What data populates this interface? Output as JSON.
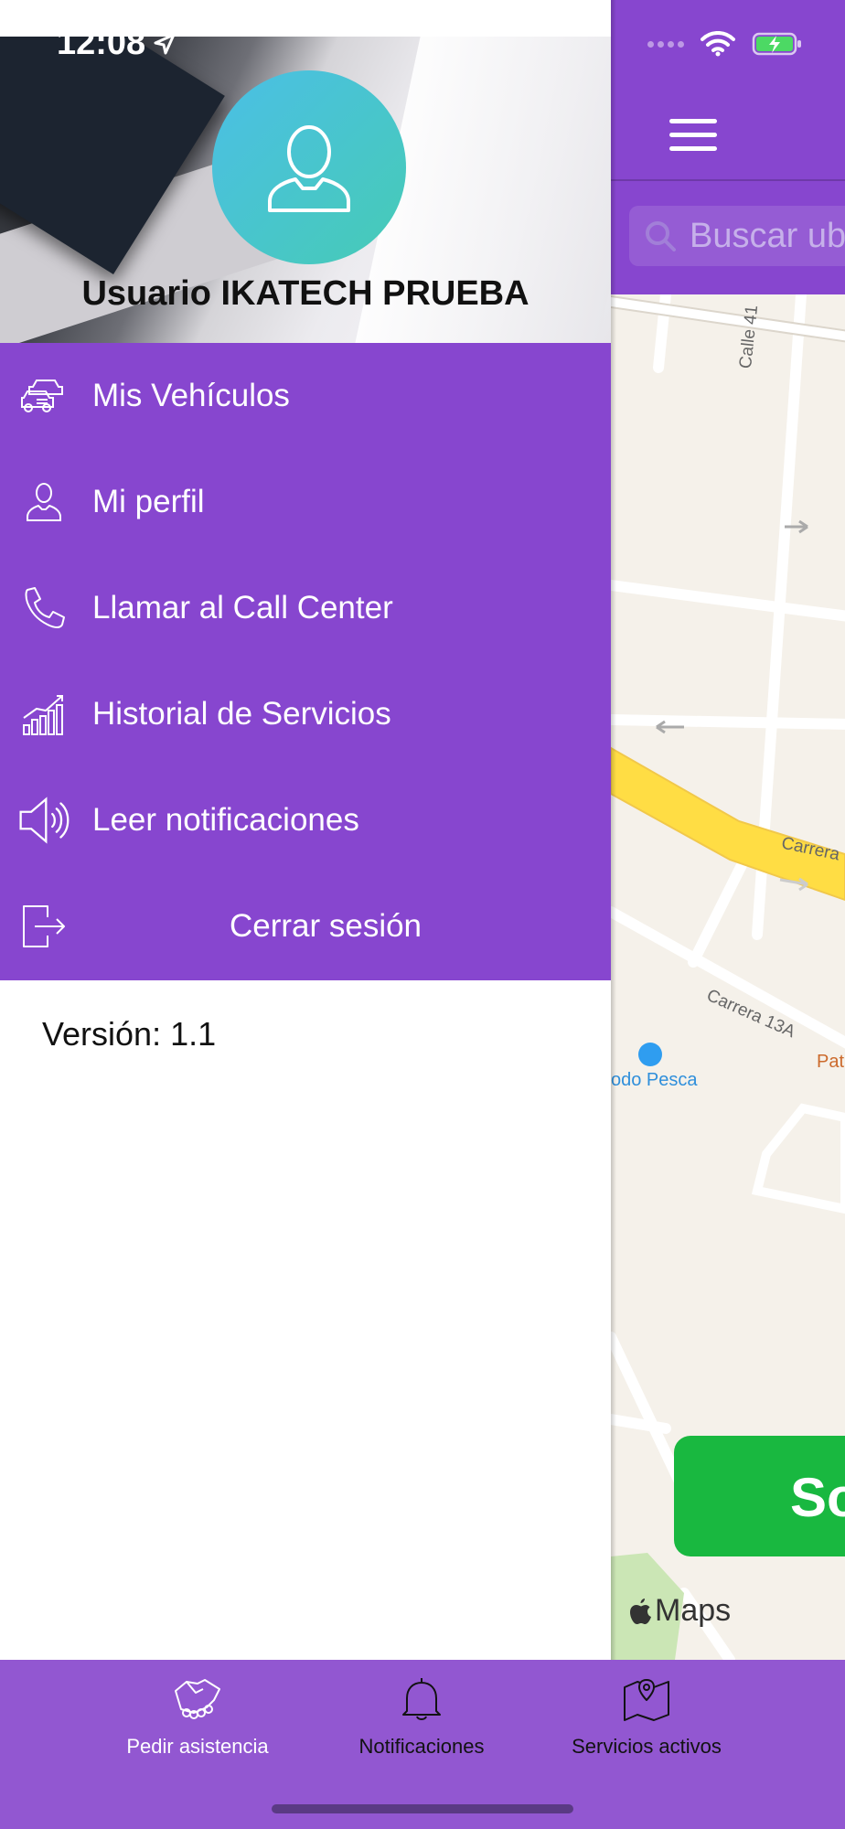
{
  "status_bar": {
    "time": "12:08"
  },
  "drawer": {
    "username": "Usuario IKATECH PRUEBA",
    "menu_items": [
      {
        "label": "Mis Vehículos",
        "icon": "cars-icon"
      },
      {
        "label": "Mi perfil",
        "icon": "user-icon"
      },
      {
        "label": "Llamar al Call Center",
        "icon": "phone-icon"
      },
      {
        "label": "Historial de Servicios",
        "icon": "chart-icon"
      },
      {
        "label": "Leer notificaciones",
        "icon": "speaker-icon"
      },
      {
        "label": "Cerrar sesión",
        "icon": "logout-icon"
      }
    ],
    "version": "Versión: 1.1"
  },
  "map_screen": {
    "search_placeholder": "Buscar ub",
    "labels": {
      "calle_41": "Calle 41",
      "carrera_top": "Carrera",
      "carrera_13a": "Carrera 13A",
      "poi_pesca": "odo Pesca",
      "poi_pat": "Pat",
      "maps_credit": "Maps"
    },
    "action_button_label": "So"
  },
  "tabbar": {
    "tabs": [
      {
        "label": "Pedir asistencia",
        "icon": "handshake-icon"
      },
      {
        "label": "Notificaciones",
        "icon": "bell-icon"
      },
      {
        "label": "Servicios activos",
        "icon": "map-pin-icon"
      }
    ]
  },
  "colors": {
    "primary": "#8746CF",
    "tabbar": "#9257D1",
    "success": "#19B840",
    "avatar_start": "#4bbfe6",
    "avatar_end": "#46cbb5"
  }
}
